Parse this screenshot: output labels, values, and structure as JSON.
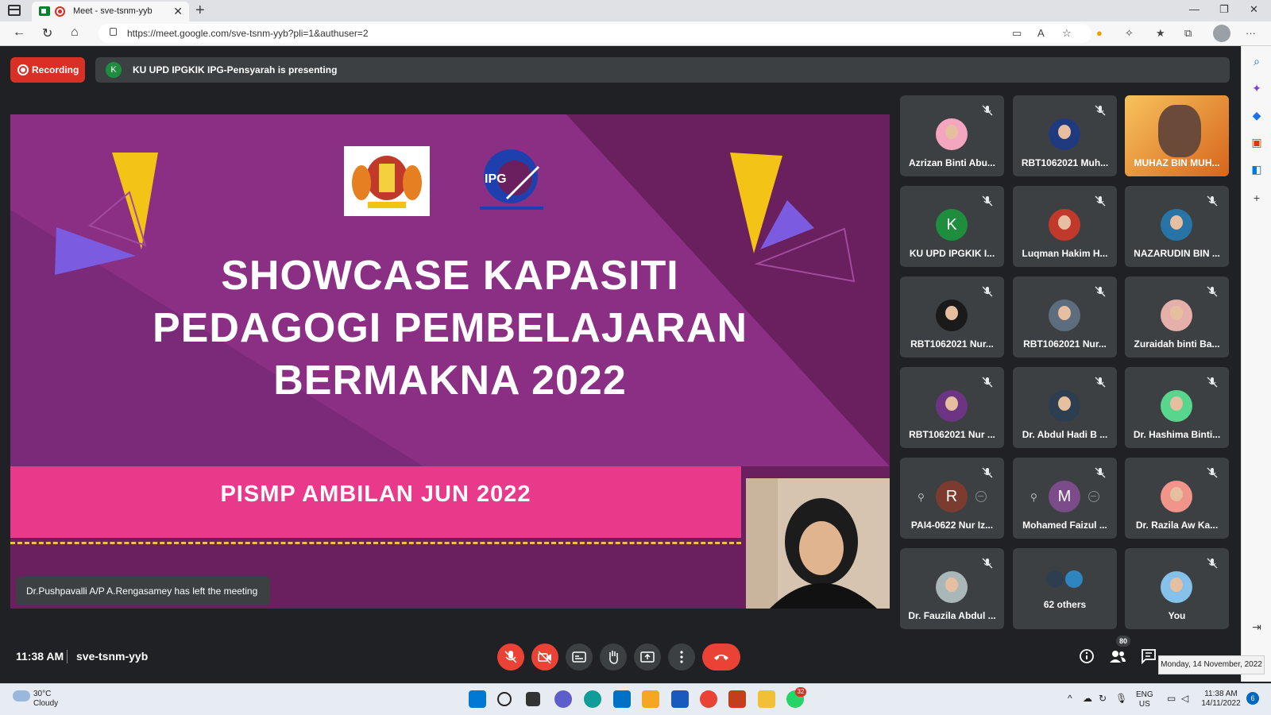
{
  "browser": {
    "tab_title": "Meet - sve-tsnm-yyb",
    "url": "https://meet.google.com/sve-tsnm-yyb?pli=1&authuser=2"
  },
  "meet": {
    "recording_label": "Recording",
    "presenter_initial": "K",
    "presenting_text": "KU UPD IPGKIK IPG-Pensyarah is presenting",
    "toast": "Dr.Pushpavalli A/P A.Rengasamey has left the meeting",
    "time": "11:38 AM",
    "meeting_code": "sve-tsnm-yyb",
    "participant_count": "80",
    "tooltip": "Monday, 14 November, 2022"
  },
  "slide": {
    "title_line1": "SHOWCASE KAPASITI",
    "title_line2": "PEDAGOGI PEMBELAJARAN",
    "title_line3": "BERMAKNA 2022",
    "subtitle": "PISMP AMBILAN JUN  2022",
    "logo2_text": "IPG"
  },
  "participants": [
    {
      "name": "Azrizan Binti Abu...",
      "av": "#f4a6c0"
    },
    {
      "name": "RBT1062021 Muh...",
      "av": "#203a80"
    },
    {
      "name": "MUHAZ BIN MUH...",
      "av": "#f5b041"
    },
    {
      "name": "KU UPD IPGKIK I...",
      "letter": "K",
      "av": "#1e8e3e"
    },
    {
      "name": "Luqman Hakim H...",
      "av": "#c0392b"
    },
    {
      "name": "NAZARUDIN BIN ...",
      "av": "#2874a6"
    },
    {
      "name": "RBT1062021 Nur...",
      "av": "#1a1a1a"
    },
    {
      "name": "RBT1062021 Nur...",
      "av": "#5d6d7e"
    },
    {
      "name": "Zuraidah binti Ba...",
      "av": "#e6b0aa"
    },
    {
      "name": "RBT1062021 Nur ...",
      "av": "#6c3483"
    },
    {
      "name": "Dr. Abdul Hadi B ...",
      "av": "#2c3e50"
    },
    {
      "name": "Dr. Hashima Binti...",
      "av": "#58d68d"
    },
    {
      "name": "PAI4-0622 Nur Iz...",
      "letter": "R",
      "av": "#7b3b2f"
    },
    {
      "name": "Mohamed Faizul ...",
      "letter": "M",
      "av": "#7b4b8a"
    },
    {
      "name": "Dr. Razila Aw Ka...",
      "av": "#f1948a"
    },
    {
      "name": "Dr. Fauzila Abdul ...",
      "av": "#aab7b8"
    },
    {
      "name": "62 others",
      "av": "#2e86c1"
    },
    {
      "name": "You",
      "av": "#85c1e9"
    }
  ],
  "taskbar": {
    "temp": "30°C",
    "weather": "Cloudy",
    "whatsapp_badge": "32",
    "lang1": "ENG",
    "lang2": "US",
    "time": "11:38 AM",
    "date": "14/11/2022",
    "notif": "6"
  }
}
